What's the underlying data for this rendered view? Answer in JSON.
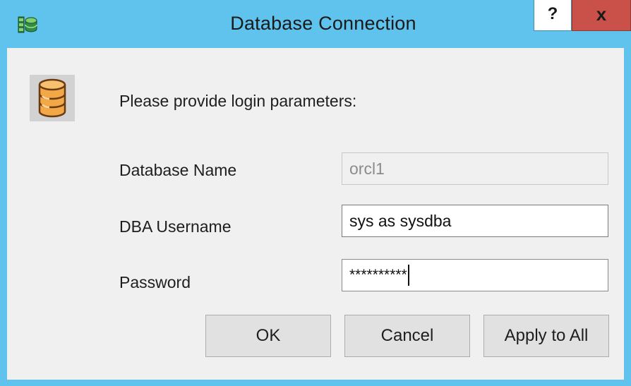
{
  "window": {
    "title": "Database Connection",
    "help_label": "?",
    "close_label": "x"
  },
  "dialog": {
    "prompt": "Please provide login parameters:",
    "fields": {
      "database_name": {
        "label": "Database Name",
        "value": "orcl1",
        "enabled": false
      },
      "dba_username": {
        "label": "DBA Username",
        "value": "sys as sysdba",
        "enabled": true
      },
      "password": {
        "label": "Password",
        "value": "**********",
        "enabled": true,
        "focused": true
      }
    },
    "buttons": {
      "ok": "OK",
      "cancel": "Cancel",
      "apply_to_all": "Apply to All"
    }
  },
  "colors": {
    "titlebar": "#5fc3ed",
    "close_button": "#c9514a",
    "client_background": "#f0f0f0",
    "button_face": "#e1e1e1",
    "database_icon": "#f0a040"
  },
  "icons": {
    "app": "database-stack-icon",
    "prompt": "database-cylinder-icon"
  }
}
